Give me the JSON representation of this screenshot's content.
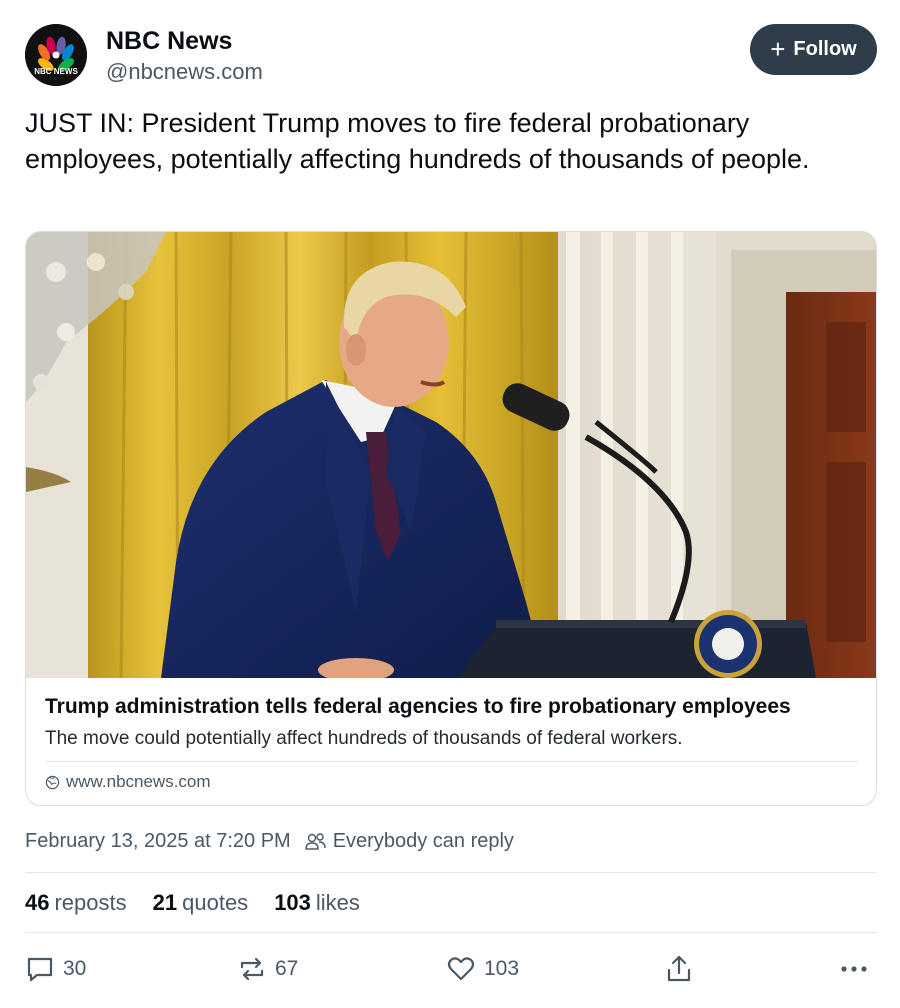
{
  "author": {
    "name": "NBC News",
    "handle": "@nbcnews.com",
    "avatar_text": "NBC NEWS"
  },
  "follow_button": {
    "label": "Follow",
    "icon": "plus-icon"
  },
  "post": {
    "text": "JUST IN: President Trump moves to fire federal probationary employees, potentially affecting hundreds of thousands of people."
  },
  "link_card": {
    "title": "Trump administration tells federal agencies to fire probationary employees",
    "description": "The move could potentially affect hundreds of thousands of federal workers.",
    "domain": "www.nbcnews.com"
  },
  "meta": {
    "timestamp": "February 13, 2025 at 7:20 PM",
    "reply_setting": "Everybody can reply"
  },
  "stats": {
    "reposts_count": "46",
    "reposts_label": "reposts",
    "quotes_count": "21",
    "quotes_label": "quotes",
    "likes_count": "103",
    "likes_label": "likes"
  },
  "actions": {
    "reply_count": "30",
    "repost_count": "67",
    "like_count": "103"
  },
  "colors": {
    "follow_bg": "#2f3d4b",
    "muted_text": "#4a5866",
    "divider": "#e3e7eb"
  }
}
